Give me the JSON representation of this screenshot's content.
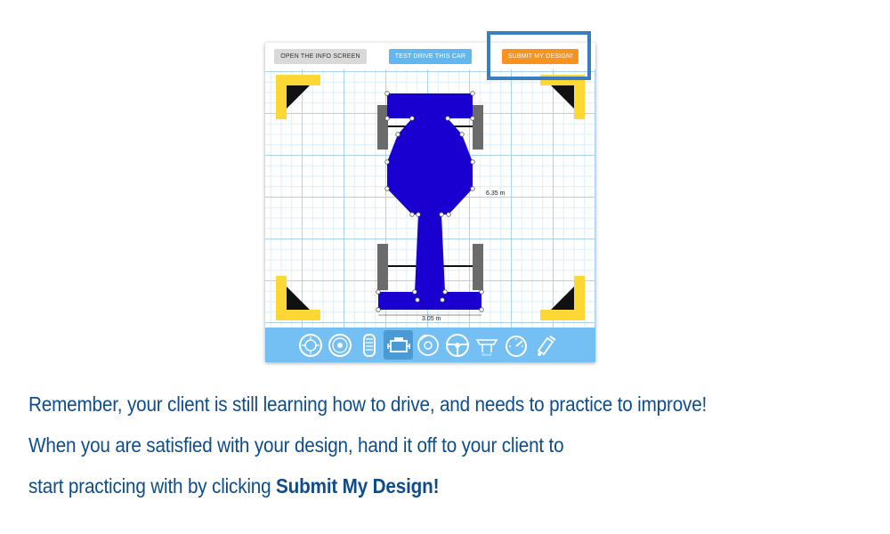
{
  "toolbar": {
    "info_label": "OPEN THE INFO SCREEN",
    "test_label": "TEST DRIVE THIS CAR",
    "submit_label": "SUBMIT MY DESIGN!"
  },
  "canvas": {
    "length_dimension": "6.35 m",
    "width_dimension": "3.05 m"
  },
  "parts": [
    {
      "name": "tire-icon"
    },
    {
      "name": "wheel-icon"
    },
    {
      "name": "tread-icon"
    },
    {
      "name": "engine-icon"
    },
    {
      "name": "brake-icon"
    },
    {
      "name": "steering-wheel-icon"
    },
    {
      "name": "rear-wing-icon"
    },
    {
      "name": "speedometer-icon"
    },
    {
      "name": "paint-icon"
    }
  ],
  "selected_part": "engine-icon",
  "caption": {
    "line1": "Remember, your client is still learning how to drive, and needs to practice to improve!",
    "line2": "When you are satisfied with your design, hand it off to your client to",
    "line3_prefix": "start practicing with by clicking ",
    "line3_bold": "Submit My Design!"
  },
  "colors": {
    "car_body": "#1a00d0",
    "submit_button": "#f7931e",
    "test_button": "#61b8f0",
    "highlight_box": "#3a7dc1",
    "corner_marker": "#fdd835",
    "caption_text": "#0f4c8a"
  }
}
